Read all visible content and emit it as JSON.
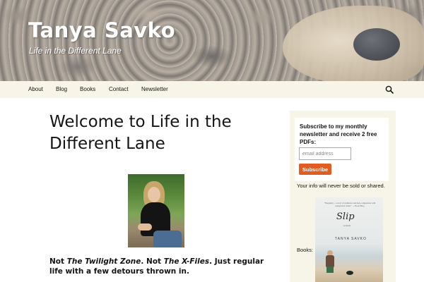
{
  "header": {
    "site_title": "Tanya Savko",
    "tagline": "Life in the Different Lane"
  },
  "nav": {
    "items": [
      {
        "label": "About"
      },
      {
        "label": "Blog"
      },
      {
        "label": "Books"
      },
      {
        "label": "Contact"
      },
      {
        "label": "Newsletter"
      }
    ],
    "search_icon": "search-icon"
  },
  "main": {
    "title": "Welcome to Life in the Different Lane",
    "photo_alt": "author-photo",
    "intro_part1": "Not ",
    "intro_em1": "The Twilight Zone",
    "intro_part2": ". Not ",
    "intro_em2": "The X-Files",
    "intro_part3": ". Just regular life with a few detours thrown in."
  },
  "sidebar": {
    "signup_text": "Subscribe to my monthly newsletter and receive 2 free PDFs:",
    "email_placeholder": "email address",
    "subscribe_label": "Subscribe",
    "privacy_text": "Your info will never be sold or shared.",
    "books_label": "Books:",
    "book": {
      "quote": "\"Engaging ... a story of resilience and deep compassion with unexpected twists.\" — Book Blog",
      "title": "Slip",
      "subtitle": "a novel",
      "author": "TANYA SAVKO"
    }
  },
  "colors": {
    "nav_bg": "#f7f5e7",
    "sidebar_bg": "#f7f5e7",
    "accent": "#e05d22",
    "text": "#141412",
    "header_title": "#ffffff"
  }
}
